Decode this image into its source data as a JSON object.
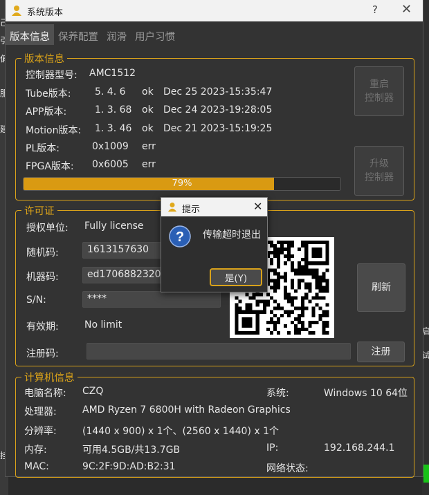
{
  "window": {
    "title": "系统版本",
    "help": "?",
    "close": "✕"
  },
  "tabs": [
    {
      "label": "版本信息",
      "active": true
    },
    {
      "label": "保养配置",
      "active": false
    },
    {
      "label": "润滑",
      "active": false
    },
    {
      "label": "用户习惯",
      "active": false
    }
  ],
  "version": {
    "legend": "版本信息",
    "controller_model_label": "控制器型号:",
    "controller_model_value": "AMC1512",
    "rows": [
      {
        "name": "Tube版本:",
        "ver": "5. 4. 6",
        "status": "ok",
        "date": "Dec 25 2023-15:35:47"
      },
      {
        "name": "APP版本:",
        "ver": "1. 3. 68",
        "status": "ok",
        "date": "Dec 24 2023-19:28:05"
      },
      {
        "name": "Motion版本:",
        "ver": "1. 3. 46",
        "status": "ok",
        "date": "Dec 21 2023-15:19:25"
      },
      {
        "name": "PL版本:",
        "ver": "0x1009",
        "status": "err",
        "date": ""
      },
      {
        "name": "FPGA版本:",
        "ver": "0x6005",
        "status": "err",
        "date": ""
      }
    ],
    "restart_line1": "重启",
    "restart_line2": "控制器",
    "upgrade_line1": "升级",
    "upgrade_line2": "控制器",
    "progress_value": 0.79,
    "progress_label": "79%"
  },
  "license": {
    "legend": "许可证",
    "unit_label": "授权单位:",
    "unit_value": "Fully license",
    "random_label": "随机码:",
    "random_value": "1613157630",
    "machine_label": "机器码:",
    "machine_value": "ed1706882320d6",
    "sn_label": "S/N:",
    "sn_value": "****",
    "validity_label": "有效期:",
    "validity_value": "No limit",
    "refresh_label": "刷新",
    "regcode_label": "注册码:",
    "regcode_value": "",
    "register_label": "注册"
  },
  "computer": {
    "legend": "计算机信息",
    "name_label": "电脑名称:",
    "name_value": "CZQ",
    "os_label": "系统:",
    "os_value": "Windows 10 64位",
    "cpu_label": "处理器:",
    "cpu_value": "AMD Ryzen 7 6800H with Radeon Graphics",
    "res_label": "分辨率:",
    "res_value": "(1440 x 900) x 1个、(2560 x 1440) x 1个",
    "mem_label": "内存:",
    "mem_value": "可用4.5GB/共13.7GB",
    "ip_label": "IP:",
    "ip_value": "192.168.244.1",
    "mac_label": "MAC:",
    "mac_value": "9C:2F:9D:AD:B2:31",
    "net_label": "网络状态:",
    "net_value": ""
  },
  "dialog": {
    "title": "提示",
    "close": "✕",
    "message": "传输超时退出",
    "yes_label": "是(Y)"
  },
  "background": {
    "left_fragments": [
      "己",
      "引",
      "偏",
      "服",
      "建"
    ],
    "right_fragments": [
      "启",
      "试"
    ],
    "bottom_left_fragment": "挂"
  },
  "colors": {
    "accent": "#d9a21a",
    "progress": "#d99a12",
    "panel": "#333333"
  }
}
